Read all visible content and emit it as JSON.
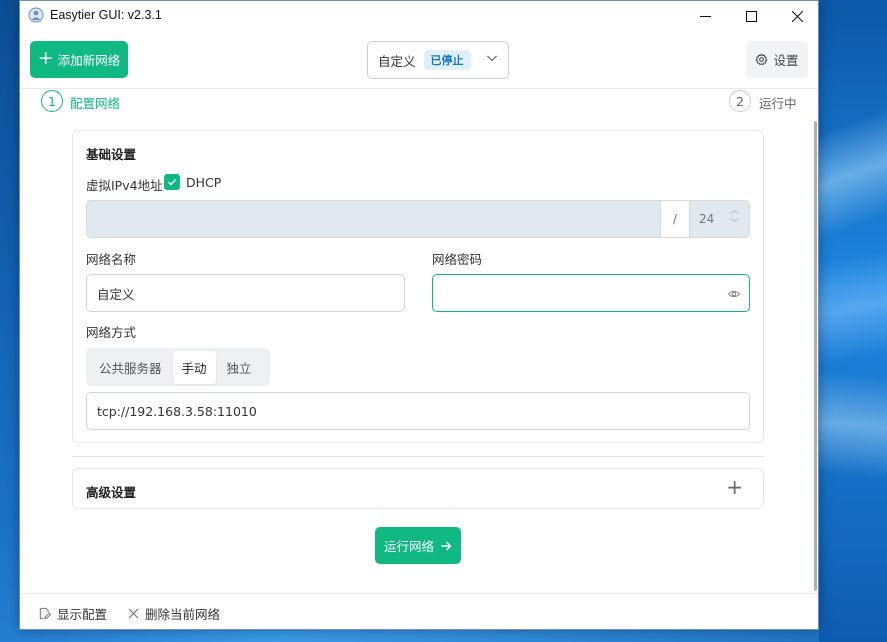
{
  "window": {
    "title": "Easytier GUI: v2.3.1"
  },
  "toolbar": {
    "add_network_label": "添加新网络",
    "selected_network": "自定义",
    "status_badge": "已停止",
    "settings_label": "设置"
  },
  "steps": [
    {
      "number": "1",
      "label": "配置网络"
    },
    {
      "number": "2",
      "label": "运行中"
    }
  ],
  "basic": {
    "title": "基础设置",
    "ipv4_label": "虚拟IPv4地址",
    "dhcp_label": "DHCP",
    "dhcp_checked": true,
    "ip_slash": "/",
    "ip_mask": "24",
    "network_name_label": "网络名称",
    "network_name_value": "自定义",
    "network_password_label": "网络密码",
    "network_password_value": "",
    "network_mode_label": "网络方式",
    "modes": [
      "公共服务器",
      "手动",
      "独立"
    ],
    "active_mode": "手动",
    "peer_url_value": "tcp://192.168.3.58:11010"
  },
  "advanced": {
    "title": "高级设置"
  },
  "run_button_label": "运行网络",
  "footer": {
    "show_config_label": "显示配置",
    "delete_network_label": "删除当前网络"
  },
  "colors": {
    "accent": "#10b981",
    "badge_bg": "#e0f0fb",
    "badge_text": "#1677c7"
  },
  "icons": [
    "app-icon",
    "minimize-icon",
    "maximize-icon",
    "close-icon",
    "plus-icon",
    "chevron-down-icon",
    "gear-icon",
    "check-icon",
    "eye-icon",
    "arrow-right-icon",
    "edit-file-icon",
    "x-icon"
  ]
}
